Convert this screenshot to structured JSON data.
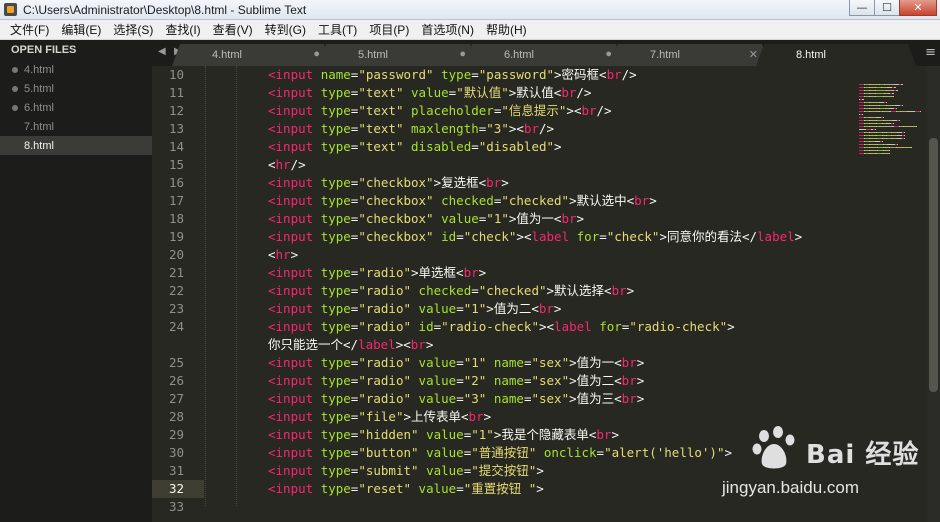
{
  "window": {
    "title": "C:\\Users\\Administrator\\Desktop\\8.html - Sublime Text",
    "controls": {
      "minimize": "—",
      "maximize": "☐",
      "close": "✕"
    }
  },
  "menu": [
    "文件(F)",
    "编辑(E)",
    "选择(S)",
    "查找(I)",
    "查看(V)",
    "转到(G)",
    "工具(T)",
    "项目(P)",
    "首选项(N)",
    "帮助(H)"
  ],
  "sidebar": {
    "header": "OPEN FILES",
    "files": [
      {
        "name": "4.html",
        "dot": true,
        "active": false
      },
      {
        "name": "5.html",
        "dot": true,
        "active": false
      },
      {
        "name": "6.html",
        "dot": true,
        "active": false
      },
      {
        "name": "7.html",
        "dot": false,
        "active": false
      },
      {
        "name": "8.html",
        "dot": false,
        "active": true
      }
    ]
  },
  "tabs": [
    {
      "label": "4.html",
      "indicator": "●",
      "active": false
    },
    {
      "label": "5.html",
      "indicator": "●",
      "active": false
    },
    {
      "label": "6.html",
      "indicator": "●",
      "active": false
    },
    {
      "label": "7.html",
      "indicator": "✕",
      "active": false
    },
    {
      "label": "8.html",
      "indicator": "",
      "active": true
    }
  ],
  "nav": {
    "prev": "◀",
    "next": "▶",
    "menu": "≡"
  },
  "editor": {
    "current_line": "32",
    "line_numbers": [
      "10",
      "11",
      "12",
      "13",
      "14",
      "15",
      "16",
      "17",
      "18",
      "19",
      "20",
      "21",
      "22",
      "23",
      "24",
      "",
      "25",
      "26",
      "27",
      "28",
      "29",
      "30",
      "31",
      "32",
      "33"
    ],
    "lines": [
      [
        [
          "t",
          "<input"
        ],
        [
          "x",
          " "
        ],
        [
          "a",
          "name"
        ],
        [
          "p",
          "="
        ],
        [
          "s",
          "\"password\""
        ],
        [
          "x",
          " "
        ],
        [
          "a",
          "type"
        ],
        [
          "p",
          "="
        ],
        [
          "s",
          "\"password\""
        ],
        [
          "p",
          ">密码框<"
        ],
        [
          "t",
          "br"
        ],
        [
          "p",
          "/>"
        ]
      ],
      [
        [
          "t",
          "<input"
        ],
        [
          "x",
          " "
        ],
        [
          "a",
          "type"
        ],
        [
          "p",
          "="
        ],
        [
          "s",
          "\"text\""
        ],
        [
          "x",
          " "
        ],
        [
          "a",
          "value"
        ],
        [
          "p",
          "="
        ],
        [
          "s",
          "\"默认值\""
        ],
        [
          "p",
          ">默认值<"
        ],
        [
          "t",
          "br"
        ],
        [
          "p",
          "/>"
        ]
      ],
      [
        [
          "t",
          "<input"
        ],
        [
          "x",
          " "
        ],
        [
          "a",
          "type"
        ],
        [
          "p",
          "="
        ],
        [
          "s",
          "\"text\""
        ],
        [
          "x",
          " "
        ],
        [
          "a",
          "placeholder"
        ],
        [
          "p",
          "="
        ],
        [
          "s",
          "\"信息提示\""
        ],
        [
          "p",
          ">"
        ],
        [
          "p",
          "<"
        ],
        [
          "t",
          "br"
        ],
        [
          "p",
          "/>"
        ]
      ],
      [
        [
          "t",
          "<input"
        ],
        [
          "x",
          " "
        ],
        [
          "a",
          "type"
        ],
        [
          "p",
          "="
        ],
        [
          "s",
          "\"text\""
        ],
        [
          "x",
          " "
        ],
        [
          "a",
          "maxlength"
        ],
        [
          "p",
          "="
        ],
        [
          "s",
          "\"3\""
        ],
        [
          "p",
          ">"
        ],
        [
          "p",
          "<"
        ],
        [
          "t",
          "br"
        ],
        [
          "p",
          "/>"
        ]
      ],
      [
        [
          "t",
          "<input"
        ],
        [
          "x",
          " "
        ],
        [
          "a",
          "type"
        ],
        [
          "p",
          "="
        ],
        [
          "s",
          "\"text\""
        ],
        [
          "x",
          " "
        ],
        [
          "a",
          "disabled"
        ],
        [
          "p",
          "="
        ],
        [
          "s",
          "\"disabled\""
        ],
        [
          "p",
          ">"
        ]
      ],
      [
        [
          "p",
          "<"
        ],
        [
          "t",
          "hr"
        ],
        [
          "p",
          "/>"
        ]
      ],
      [
        [
          "t",
          "<input"
        ],
        [
          "x",
          " "
        ],
        [
          "a",
          "type"
        ],
        [
          "p",
          "="
        ],
        [
          "s",
          "\"checkbox\""
        ],
        [
          "p",
          ">复选框<"
        ],
        [
          "t",
          "br"
        ],
        [
          "p",
          ">"
        ]
      ],
      [
        [
          "t",
          "<input"
        ],
        [
          "x",
          " "
        ],
        [
          "a",
          "type"
        ],
        [
          "p",
          "="
        ],
        [
          "s",
          "\"checkbox\""
        ],
        [
          "x",
          " "
        ],
        [
          "a",
          "checked"
        ],
        [
          "p",
          "="
        ],
        [
          "s",
          "\"checked\""
        ],
        [
          "p",
          ">默认选中<"
        ],
        [
          "t",
          "br"
        ],
        [
          "p",
          ">"
        ]
      ],
      [
        [
          "t",
          "<input"
        ],
        [
          "x",
          " "
        ],
        [
          "a",
          "type"
        ],
        [
          "p",
          "="
        ],
        [
          "s",
          "\"checkbox\""
        ],
        [
          "x",
          " "
        ],
        [
          "a",
          "value"
        ],
        [
          "p",
          "="
        ],
        [
          "s",
          "\"1\""
        ],
        [
          "p",
          ">值为一<"
        ],
        [
          "t",
          "br"
        ],
        [
          "p",
          ">"
        ]
      ],
      [
        [
          "t",
          "<input"
        ],
        [
          "x",
          " "
        ],
        [
          "a",
          "type"
        ],
        [
          "p",
          "="
        ],
        [
          "s",
          "\"checkbox\""
        ],
        [
          "x",
          " "
        ],
        [
          "a",
          "id"
        ],
        [
          "p",
          "="
        ],
        [
          "s",
          "\"check\""
        ],
        [
          "p",
          ">"
        ],
        [
          "p",
          "<"
        ],
        [
          "t",
          "label"
        ],
        [
          "x",
          " "
        ],
        [
          "a",
          "for"
        ],
        [
          "p",
          "="
        ],
        [
          "s",
          "\"check\""
        ],
        [
          "p",
          ">同意你的看法</"
        ],
        [
          "t",
          "label"
        ],
        [
          "p",
          ">"
        ]
      ],
      [
        [
          "p",
          "<"
        ],
        [
          "t",
          "hr"
        ],
        [
          "p",
          ">"
        ]
      ],
      [
        [
          "t",
          "<input"
        ],
        [
          "x",
          " "
        ],
        [
          "a",
          "type"
        ],
        [
          "p",
          "="
        ],
        [
          "s",
          "\"radio\""
        ],
        [
          "p",
          ">单选框<"
        ],
        [
          "t",
          "br"
        ],
        [
          "p",
          ">"
        ]
      ],
      [
        [
          "t",
          "<input"
        ],
        [
          "x",
          " "
        ],
        [
          "a",
          "type"
        ],
        [
          "p",
          "="
        ],
        [
          "s",
          "\"radio\""
        ],
        [
          "x",
          " "
        ],
        [
          "a",
          "checked"
        ],
        [
          "p",
          "="
        ],
        [
          "s",
          "\"checked\""
        ],
        [
          "p",
          ">默认选择<"
        ],
        [
          "t",
          "br"
        ],
        [
          "p",
          ">"
        ]
      ],
      [
        [
          "t",
          "<input"
        ],
        [
          "x",
          " "
        ],
        [
          "a",
          "type"
        ],
        [
          "p",
          "="
        ],
        [
          "s",
          "\"radio\""
        ],
        [
          "x",
          " "
        ],
        [
          "a",
          "value"
        ],
        [
          "p",
          "="
        ],
        [
          "s",
          "\"1\""
        ],
        [
          "p",
          ">值为二<"
        ],
        [
          "t",
          "br"
        ],
        [
          "p",
          ">"
        ]
      ],
      [
        [
          "t",
          "<input"
        ],
        [
          "x",
          " "
        ],
        [
          "a",
          "type"
        ],
        [
          "p",
          "="
        ],
        [
          "s",
          "\"radio\""
        ],
        [
          "x",
          " "
        ],
        [
          "a",
          "id"
        ],
        [
          "p",
          "="
        ],
        [
          "s",
          "\"radio-check\""
        ],
        [
          "p",
          ">"
        ],
        [
          "p",
          "<"
        ],
        [
          "t",
          "label"
        ],
        [
          "x",
          " "
        ],
        [
          "a",
          "for"
        ],
        [
          "p",
          "="
        ],
        [
          "s",
          "\"radio-check\""
        ],
        [
          "p",
          ">"
        ]
      ],
      [
        [
          "p",
          "你只能选一个</"
        ],
        [
          "t",
          "label"
        ],
        [
          "p",
          "><"
        ],
        [
          "t",
          "br"
        ],
        [
          "p",
          ">"
        ]
      ],
      [
        [
          "t",
          "<input"
        ],
        [
          "x",
          " "
        ],
        [
          "a",
          "type"
        ],
        [
          "p",
          "="
        ],
        [
          "s",
          "\"radio\""
        ],
        [
          "x",
          " "
        ],
        [
          "a",
          "value"
        ],
        [
          "p",
          "="
        ],
        [
          "s",
          "\"1\""
        ],
        [
          "x",
          " "
        ],
        [
          "a",
          "name"
        ],
        [
          "p",
          "="
        ],
        [
          "s",
          "\"sex\""
        ],
        [
          "p",
          ">值为一<"
        ],
        [
          "t",
          "br"
        ],
        [
          "p",
          ">"
        ]
      ],
      [
        [
          "t",
          "<input"
        ],
        [
          "x",
          " "
        ],
        [
          "a",
          "type"
        ],
        [
          "p",
          "="
        ],
        [
          "s",
          "\"radio\""
        ],
        [
          "x",
          " "
        ],
        [
          "a",
          "value"
        ],
        [
          "p",
          "="
        ],
        [
          "s",
          "\"2\""
        ],
        [
          "x",
          " "
        ],
        [
          "a",
          "name"
        ],
        [
          "p",
          "="
        ],
        [
          "s",
          "\"sex\""
        ],
        [
          "p",
          ">值为二<"
        ],
        [
          "t",
          "br"
        ],
        [
          "p",
          ">"
        ]
      ],
      [
        [
          "t",
          "<input"
        ],
        [
          "x",
          " "
        ],
        [
          "a",
          "type"
        ],
        [
          "p",
          "="
        ],
        [
          "s",
          "\"radio\""
        ],
        [
          "x",
          " "
        ],
        [
          "a",
          "value"
        ],
        [
          "p",
          "="
        ],
        [
          "s",
          "\"3\""
        ],
        [
          "x",
          " "
        ],
        [
          "a",
          "name"
        ],
        [
          "p",
          "="
        ],
        [
          "s",
          "\"sex\""
        ],
        [
          "p",
          ">值为三<"
        ],
        [
          "t",
          "br"
        ],
        [
          "p",
          ">"
        ]
      ],
      [
        [
          "t",
          "<input"
        ],
        [
          "x",
          " "
        ],
        [
          "a",
          "type"
        ],
        [
          "p",
          "="
        ],
        [
          "s",
          "\"file\""
        ],
        [
          "p",
          ">上传表单<"
        ],
        [
          "t",
          "br"
        ],
        [
          "p",
          ">"
        ]
      ],
      [
        [
          "t",
          "<input"
        ],
        [
          "x",
          " "
        ],
        [
          "a",
          "type"
        ],
        [
          "p",
          "="
        ],
        [
          "s",
          "\"hidden\""
        ],
        [
          "x",
          " "
        ],
        [
          "a",
          "value"
        ],
        [
          "p",
          "="
        ],
        [
          "s",
          "\"1\""
        ],
        [
          "p",
          ">我是个隐藏表单<"
        ],
        [
          "t",
          "br"
        ],
        [
          "p",
          ">"
        ]
      ],
      [
        [
          "t",
          "<input"
        ],
        [
          "x",
          " "
        ],
        [
          "a",
          "type"
        ],
        [
          "p",
          "="
        ],
        [
          "s",
          "\"button\""
        ],
        [
          "x",
          " "
        ],
        [
          "a",
          "value"
        ],
        [
          "p",
          "="
        ],
        [
          "s",
          "\"普通按钮\""
        ],
        [
          "x",
          " "
        ],
        [
          "a",
          "onclick"
        ],
        [
          "p",
          "="
        ],
        [
          "s",
          "\"alert('hello')\""
        ],
        [
          "p",
          ">"
        ]
      ],
      [
        [
          "t",
          "<input"
        ],
        [
          "x",
          " "
        ],
        [
          "a",
          "type"
        ],
        [
          "p",
          "="
        ],
        [
          "s",
          "\"submit\""
        ],
        [
          "x",
          " "
        ],
        [
          "a",
          "value"
        ],
        [
          "p",
          "="
        ],
        [
          "s",
          "\"提交按钮\""
        ],
        [
          "p",
          ">"
        ]
      ],
      [
        [
          "t",
          "<input"
        ],
        [
          "x",
          " "
        ],
        [
          "a",
          "type"
        ],
        [
          "p",
          "="
        ],
        [
          "s",
          "\"reset\""
        ],
        [
          "x",
          " "
        ],
        [
          "a",
          "value"
        ],
        [
          "p",
          "="
        ],
        [
          "s",
          "\"重置按钮 \""
        ],
        [
          "p",
          ">"
        ]
      ],
      []
    ]
  },
  "colors": {
    "background": "#272822",
    "tag": "#f92672",
    "attribute": "#a6e22e",
    "string": "#e6db74",
    "text": "#f8f8f2",
    "line_number": "#90908a",
    "current_line": "#3e3d32"
  },
  "watermark": {
    "brand": "Bai 经验",
    "url": "jingyan.baidu.com"
  }
}
